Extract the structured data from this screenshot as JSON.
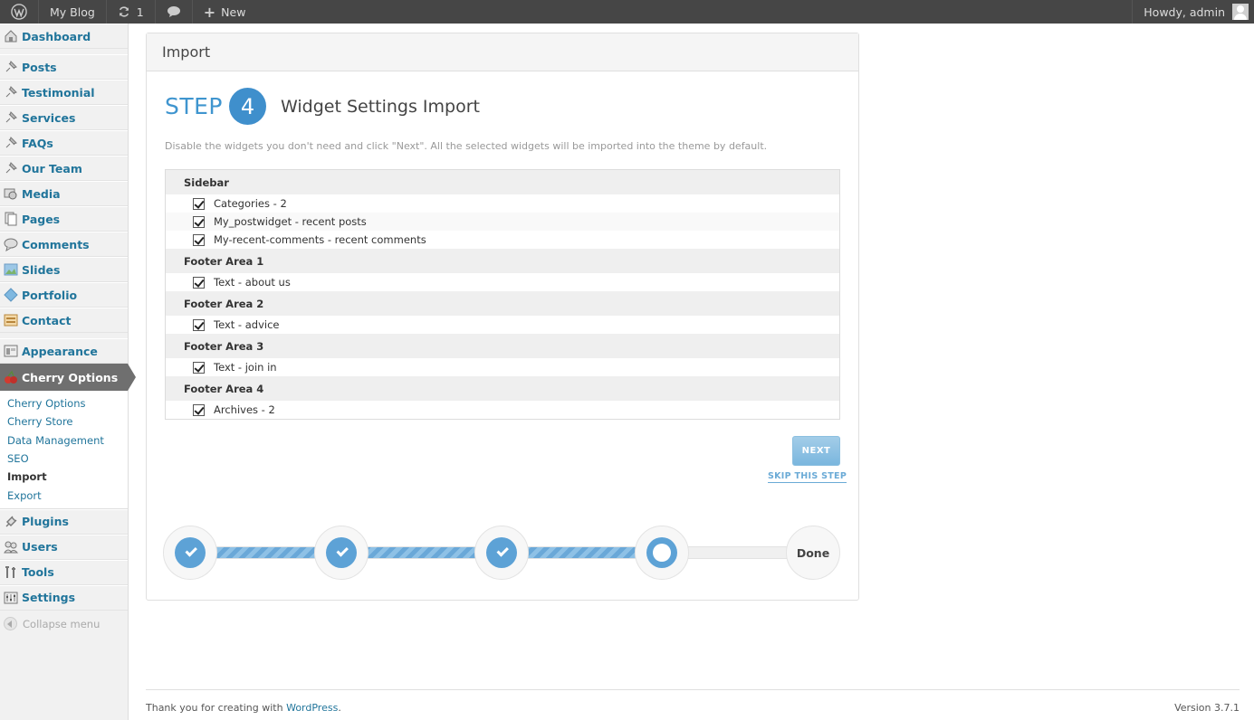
{
  "adminbar": {
    "site_name": "My Blog",
    "updates_count": "1",
    "new_label": "New",
    "howdy": "Howdy, admin"
  },
  "sidebar": {
    "items": [
      {
        "label": "Dashboard",
        "icon": "dashboard-icon"
      },
      {
        "label": "Posts",
        "icon": "pin-icon"
      },
      {
        "label": "Testimonial",
        "icon": "pin-icon"
      },
      {
        "label": "Services",
        "icon": "pin-icon"
      },
      {
        "label": "FAQs",
        "icon": "pin-icon"
      },
      {
        "label": "Our Team",
        "icon": "pin-icon"
      },
      {
        "label": "Media",
        "icon": "media-icon"
      },
      {
        "label": "Pages",
        "icon": "pages-icon"
      },
      {
        "label": "Comments",
        "icon": "comment-icon"
      },
      {
        "label": "Slides",
        "icon": "slides-icon"
      },
      {
        "label": "Portfolio",
        "icon": "portfolio-icon"
      },
      {
        "label": "Contact",
        "icon": "contact-icon"
      },
      {
        "label": "Appearance",
        "icon": "appearance-icon"
      },
      {
        "label": "Cherry Options",
        "icon": "cherry-icon"
      },
      {
        "label": "Plugins",
        "icon": "plugin-icon"
      },
      {
        "label": "Users",
        "icon": "users-icon"
      },
      {
        "label": "Tools",
        "icon": "tools-icon"
      },
      {
        "label": "Settings",
        "icon": "settings-icon"
      }
    ],
    "submenu": [
      "Cherry Options",
      "Cherry Store",
      "Data Management",
      "SEO",
      "Import",
      "Export"
    ],
    "collapse_label": "Collapse menu"
  },
  "panel": {
    "title": "Import",
    "step_word": "STEP",
    "step_number": "4",
    "step_title": "Widget Settings Import",
    "description": "Disable the widgets you don't need and click \"Next\". All the selected widgets will be imported into the theme by default.",
    "groups": [
      {
        "name": "Sidebar",
        "widgets": [
          "Categories - 2",
          "My_postwidget - recent posts",
          "My-recent-comments - recent comments"
        ]
      },
      {
        "name": "Footer Area 1",
        "widgets": [
          "Text - about us"
        ]
      },
      {
        "name": "Footer Area 2",
        "widgets": [
          "Text - advice"
        ]
      },
      {
        "name": "Footer Area 3",
        "widgets": [
          "Text - join in"
        ]
      },
      {
        "name": "Footer Area 4",
        "widgets": [
          "Archives - 2"
        ]
      }
    ],
    "next_label": "NEXT",
    "skip_label": "SKIP THIS STEP",
    "progress_done_label": "Done"
  },
  "footer": {
    "thanks_prefix": "Thank you for creating with ",
    "wordpress_link": "WordPress",
    "thanks_suffix": ".",
    "version": "Version 3.7.1"
  },
  "colors": {
    "accent": "#3f95cf",
    "link": "#21759b",
    "adminbar_bg": "#464646"
  }
}
